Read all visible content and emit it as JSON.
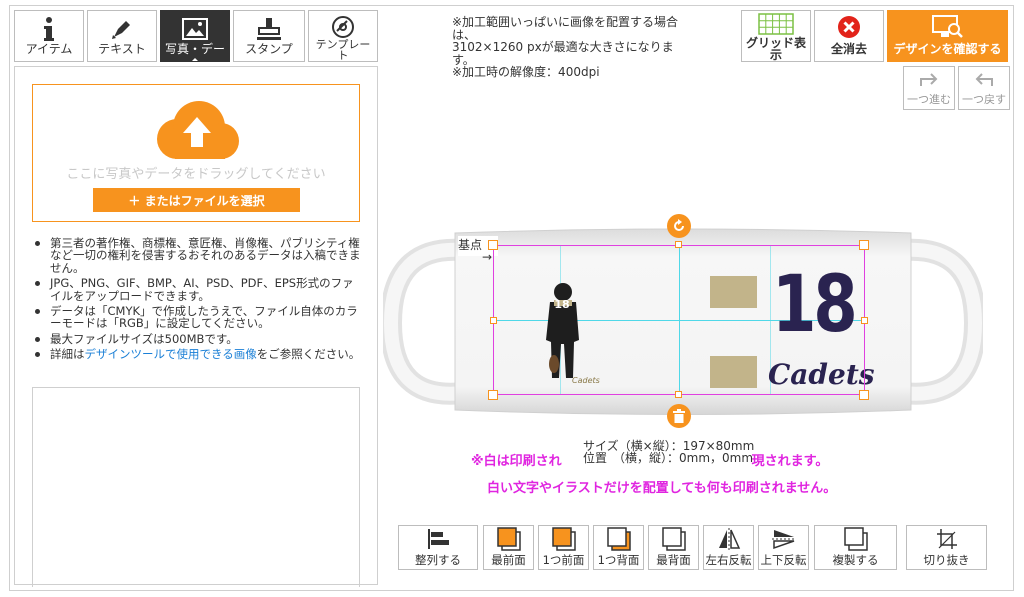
{
  "tabs": [
    {
      "id": "item",
      "label": "アイテム",
      "icon": "info-icon"
    },
    {
      "id": "text",
      "label": "テキスト",
      "icon": "pen-icon"
    },
    {
      "id": "photo",
      "label": "写真・デー",
      "icon": "image-icon",
      "active": true
    },
    {
      "id": "stamp",
      "label": "スタンプ",
      "icon": "stamp-icon"
    },
    {
      "id": "template",
      "label": "テンプレー\nト",
      "icon": "disc-icon"
    }
  ],
  "upload": {
    "hint": "ここに写真やデータをドラッグしてください",
    "button": "＋ またはファイルを選択"
  },
  "notes": {
    "n1": "第三者の著作権、商標権、意匠権、肖像権、パブリシティ権など一切の権利を侵害するおそれのあるデータは入稿できません。",
    "n2": "JPG、PNG、GIF、BMP、AI、PSD、PDF、EPS形式のファイルをアップロードできます。",
    "n3": "データは「CMYK」で作成したうえで、ファイル自体のカラーモードは「RGB」に設定してください。",
    "n4": "最大ファイルサイズは500MBです。",
    "n5_pre": "詳細は",
    "n5_link": "デザインツールで使用できる画像",
    "n5_post": "をご参照ください。"
  },
  "info": {
    "line1": "※加工範囲いっぱいに画像を配置する場合は、",
    "line2": "3102×1260 pxが最適な大きさになります。",
    "line3": "※加工時の解像度：400dpi"
  },
  "top_buttons": {
    "grid": "グリッド表示",
    "clear": "全消去",
    "confirm": "デザインを確認する"
  },
  "history": {
    "redo": "一つ進む",
    "undo": "一つ戻す"
  },
  "canvas": {
    "origin_label": "基点",
    "number": "18",
    "team": "Cadets",
    "jersey_number": "18",
    "size_line": "サイズ（横×縦）：197×80mm",
    "pos_line": "位置　（横，縦）：0mm，0mm",
    "warn1_a": "※白は印刷され",
    "warn1_b": "現されます。",
    "warn2": "白い文字やイラストだけを配置しても何も印刷されません。"
  },
  "toolbar": {
    "align": "整列する",
    "front": "最前面",
    "forward": "1つ前面",
    "backward": "1つ背面",
    "back": "最背面",
    "flip_h": "左右反転",
    "flip_v": "上下反転",
    "duplicate": "複製する",
    "crop": "切り抜き"
  },
  "colors": {
    "accent": "#f7931e",
    "warn": "#e025e0",
    "link": "#1a7fd6",
    "selection": "#e040e0",
    "guide": "#4fd8e8",
    "navy": "#2a2350",
    "khaki": "#c2b48a"
  }
}
